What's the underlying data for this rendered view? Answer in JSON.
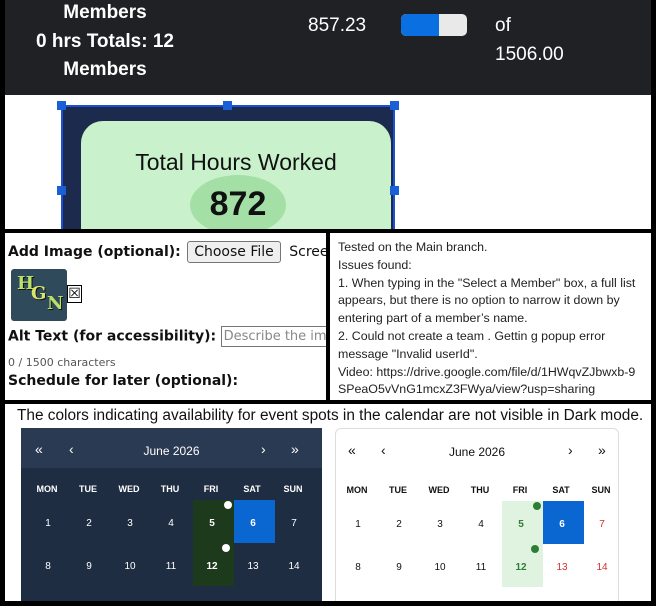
{
  "stats_bar": {
    "label_top": "Members",
    "label_mid": "0 hrs Totals: 12",
    "label_bottom": "Members",
    "value": "857.23",
    "progress_fraction": 0.57,
    "of_label": "of",
    "total": "1506.00"
  },
  "editor_card": {
    "title": "Total Hours Worked",
    "value": "872"
  },
  "image_form": {
    "add_image_label": "Add Image (optional):",
    "choose_file_button": "Choose File",
    "file_name": "Screen Shot",
    "thumbnail_text": "HGN",
    "remove_symbol": "☒",
    "alt_text_label": "Alt Text (for accessibility):",
    "alt_text_placeholder": "Describe the image fo",
    "char_count": "0 / 1500 characters",
    "schedule_label": "Schedule for later (optional):"
  },
  "issue_notes": {
    "line1": "Tested on the Main branch.",
    "line2": "Issues found:",
    "line3": "1. When typing in the \"Select a Member\" box, a full list appears, but there is no option to narrow it down by entering part of a member’s name.",
    "line4": "2. Could not create a team . Gettin g popup error message \"Invalid userId\".",
    "line5": "Video:  https://drive.google.com/file/d/1HWqvZJbwxb-9SPeaO5vVnG1mcxZ3FWya/view?usp=sharing"
  },
  "calendar_section": {
    "caption": "The colors indicating availability for event spots in the calendar are not visible in Dark mode.",
    "nav": {
      "first": "«",
      "prev": "‹",
      "next": "›",
      "last": "»"
    },
    "month": "June 2026",
    "weekdays": [
      "MON",
      "TUE",
      "WED",
      "THU",
      "FRI",
      "SAT",
      "SUN"
    ],
    "week1": [
      "1",
      "2",
      "3",
      "4",
      "5",
      "6",
      "7"
    ],
    "week2": [
      "8",
      "9",
      "10",
      "11",
      "12",
      "13",
      "14"
    ],
    "colors": {
      "dark_bg": "#1f2d42",
      "dark_available": "#1e3a1c",
      "selected": "#0a66d1",
      "light_available": "#e0f3e0",
      "available_dot_dark": "#ffffff",
      "available_dot_light": "#2e7d32",
      "weekend_red": "#d32f2f"
    }
  }
}
